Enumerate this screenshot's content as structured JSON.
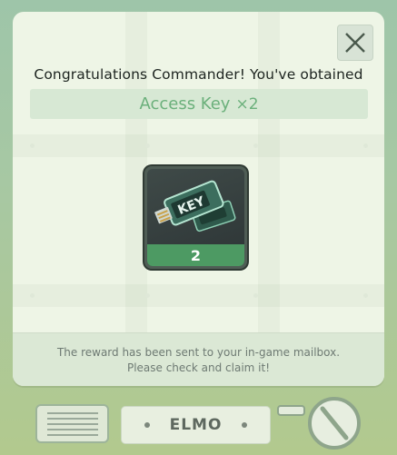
{
  "dialog": {
    "title": "Congratulations Commander! You've obtained",
    "reward_name": "Access Key",
    "reward_qty": "×2",
    "item_count": "2",
    "notice": "The reward has been sent to your in-game mailbox. Please check and claim it!",
    "item_icon": "access-key-icon",
    "close_icon": "close-icon"
  },
  "console": {
    "name": "ELMO"
  },
  "colors": {
    "reward_text": "#6bb07b",
    "count_bar": "#4d9a63",
    "panel": "#eef5e6"
  }
}
